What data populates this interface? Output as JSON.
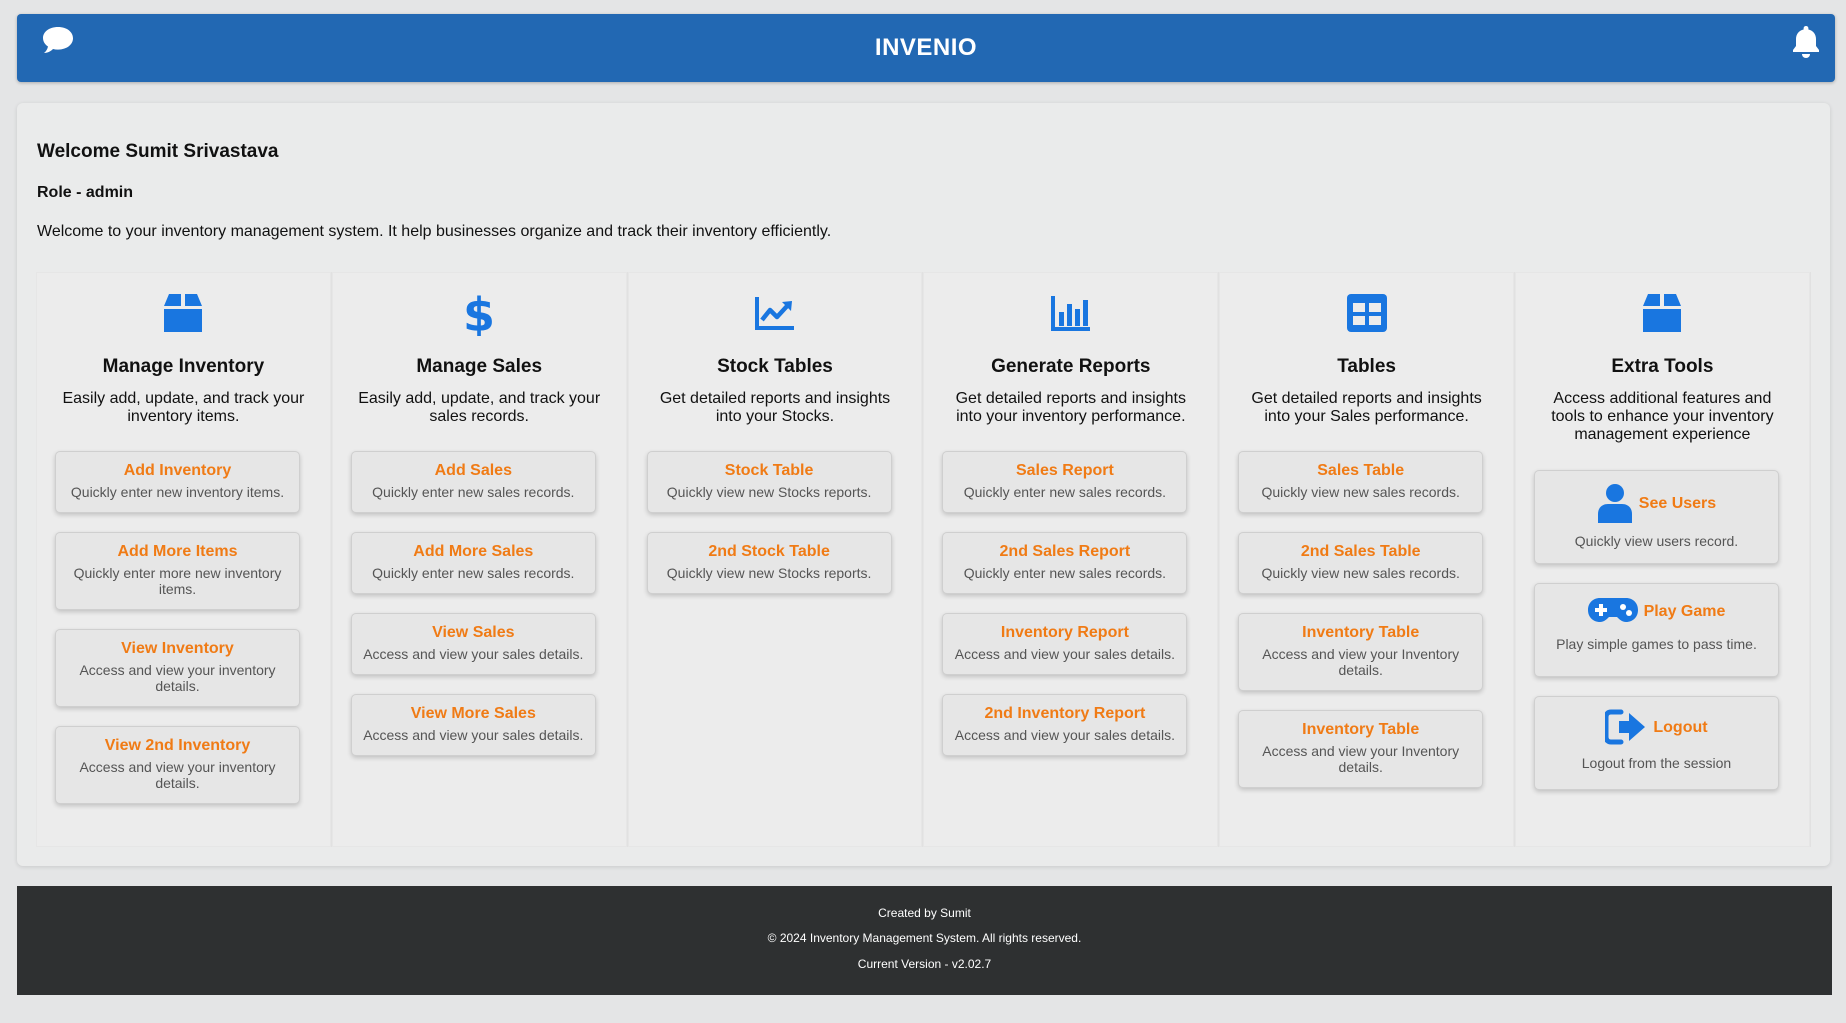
{
  "header": {
    "title": "INVENIO",
    "chat_icon": "chat-bubble-icon",
    "bell_icon": "bell-icon",
    "color": "#2268b3"
  },
  "welcome": {
    "greeting": "Welcome Sumit Srivastava",
    "role": "Role - admin",
    "intro": "Welcome to your inventory management system. It help businesses organize and track their inventory efficiently."
  },
  "columns": [
    {
      "icon": "box-icon",
      "title": "Manage Inventory",
      "desc": "Easily add, update, and track your inventory items.",
      "cards": [
        {
          "title": "Add Inventory",
          "sub": "Quickly enter new inventory items."
        },
        {
          "title": "Add More Items",
          "sub": "Quickly enter more new inventory items."
        },
        {
          "title": "View Inventory",
          "sub": "Access and view your inventory details."
        },
        {
          "title": "View 2nd Inventory",
          "sub": "Access and view your inventory details."
        }
      ]
    },
    {
      "icon": "dollar-icon",
      "title": "Manage Sales",
      "desc": "Easily add, update, and track your sales records.",
      "cards": [
        {
          "title": "Add Sales",
          "sub": "Quickly enter new sales records."
        },
        {
          "title": "Add More Sales",
          "sub": "Quickly enter new sales records."
        },
        {
          "title": "View Sales",
          "sub": "Access and view your sales details."
        },
        {
          "title": "View More Sales",
          "sub": "Access and view your sales details."
        }
      ]
    },
    {
      "icon": "line-chart-icon",
      "title": "Stock Tables",
      "desc": "Get detailed reports and insights into your Stocks.",
      "cards": [
        {
          "title": "Stock Table",
          "sub": "Quickly view new Stocks reports."
        },
        {
          "title": "2nd Stock Table",
          "sub": "Quickly view new Stocks reports."
        }
      ]
    },
    {
      "icon": "bar-chart-icon",
      "title": "Generate Reports",
      "desc": "Get detailed reports and insights into your inventory performance.",
      "cards": [
        {
          "title": "Sales Report",
          "sub": "Quickly enter new sales records."
        },
        {
          "title": "2nd Sales Report",
          "sub": "Quickly enter new sales records."
        },
        {
          "title": "Inventory Report",
          "sub": "Access and view your sales details."
        },
        {
          "title": "2nd Inventory Report",
          "sub": "Access and view your sales details."
        }
      ]
    },
    {
      "icon": "table-icon",
      "title": "Tables",
      "desc": "Get detailed reports and insights into your Sales performance.",
      "cards": [
        {
          "title": "Sales Table",
          "sub": "Quickly view new sales records."
        },
        {
          "title": "2nd Sales Table",
          "sub": "Quickly view new sales records."
        },
        {
          "title": "Inventory Table",
          "sub": "Access and view your Inventory details."
        },
        {
          "title": "Inventory Table",
          "sub": "Access and view your Inventory details."
        }
      ]
    },
    {
      "icon": "box-icon",
      "title": "Extra Tools",
      "desc": "Access additional features and tools to enhance your inventory management experience",
      "cards": [
        {
          "icon": "user-icon",
          "title": "See Users",
          "sub": "Quickly view users record."
        },
        {
          "icon": "gamepad-icon",
          "title": "Play Game",
          "sub": "Play simple games to pass time."
        },
        {
          "icon": "logout-icon",
          "title": "Logout",
          "sub": "Logout from the session"
        }
      ]
    }
  ],
  "footer": {
    "created": "Created by Sumit",
    "copyright": "© 2024 Inventory Management System. All rights reserved.",
    "version": "Current Version - v2.02.7"
  },
  "colors": {
    "accent": "#2268b3",
    "icon_blue": "#1976e0",
    "card_title_orange": "#f07b15",
    "footer_bg": "#2e3031"
  }
}
